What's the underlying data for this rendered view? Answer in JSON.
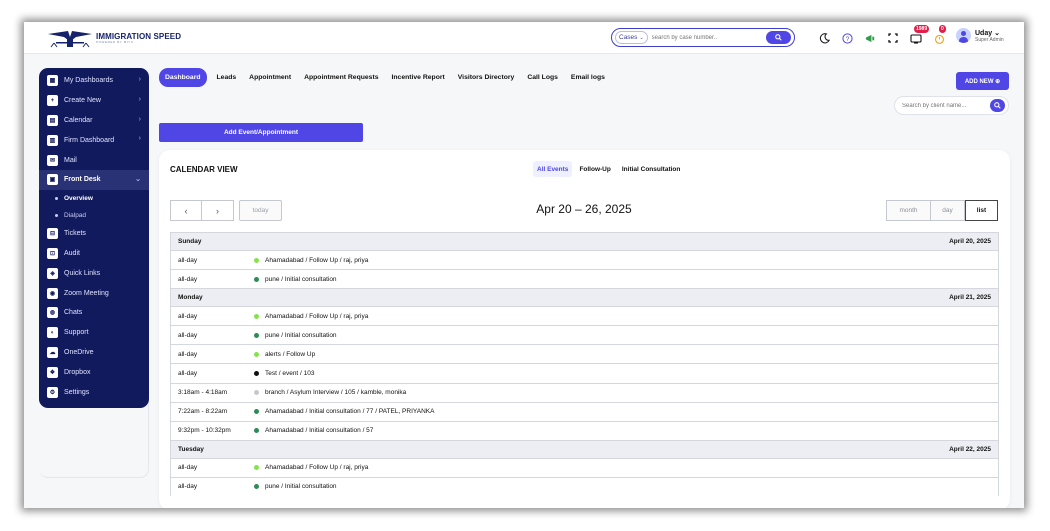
{
  "header": {
    "logo_name": "IMMIGRATION SPEED",
    "logo_sub": "POWERED BY MYIS",
    "case_select": "Cases",
    "search_placeholder": "search by case number..",
    "notif_badge": "1989",
    "alert_badge": "0",
    "user_name": "Uday",
    "user_role": "Super Admin"
  },
  "sidebar": {
    "items": [
      {
        "label": "My Dashboards",
        "icon": "grid-icon",
        "chev": true
      },
      {
        "label": "Create New",
        "icon": "plus-icon",
        "chev": true
      },
      {
        "label": "Calendar",
        "icon": "calendar-icon",
        "chev": true
      },
      {
        "label": "Firm Dashboard",
        "icon": "building-icon",
        "chev": true
      },
      {
        "label": "Mail",
        "icon": "mail-icon",
        "chev": false
      },
      {
        "label": "Front Desk",
        "icon": "desk-icon",
        "chev": true,
        "active": true
      }
    ],
    "sub_items": [
      {
        "label": "Overview",
        "active": true
      },
      {
        "label": "Dialpad",
        "active": false
      }
    ],
    "items2": [
      {
        "label": "Tickets",
        "icon": "ticket-icon"
      },
      {
        "label": "Audit",
        "icon": "audit-icon"
      },
      {
        "label": "Quick Links",
        "icon": "link-icon"
      },
      {
        "label": "Zoom Meeting",
        "icon": "video-icon"
      },
      {
        "label": "Chats",
        "icon": "chat-icon"
      },
      {
        "label": "Support",
        "icon": "headset-icon"
      },
      {
        "label": "OneDrive",
        "icon": "cloud-icon"
      },
      {
        "label": "Dropbox",
        "icon": "dropbox-icon"
      },
      {
        "label": "Settings",
        "icon": "gear-icon"
      }
    ]
  },
  "tabs": [
    "Dashboard",
    "Leads",
    "Appointment",
    "Appointment Requests",
    "Incentive Report",
    "Visitors Directory",
    "Call Logs",
    "Email logs"
  ],
  "add_new": "ADD NEW ⊕",
  "client_search_placeholder": "Search by client name...",
  "add_event": "Add Event/Appointment",
  "calendar": {
    "title": "CALENDAR VIEW",
    "filters": [
      "All Events",
      "Follow-Up",
      "Initial Consultation"
    ],
    "today": "today",
    "range": "Apr 20 – 26, 2025",
    "views": [
      "month",
      "day",
      "list"
    ],
    "days": [
      {
        "name": "Sunday",
        "date": "April 20, 2025",
        "events": [
          {
            "time": "all-day",
            "title": "Ahamadabad / Follow Up / raj, priya",
            "color": "#84e34a"
          },
          {
            "time": "all-day",
            "title": "pune / Initial consultation",
            "color": "#2e8b57"
          }
        ]
      },
      {
        "name": "Monday",
        "date": "April 21, 2025",
        "events": [
          {
            "time": "all-day",
            "title": "Ahamadabad / Follow Up / raj, priya",
            "color": "#84e34a"
          },
          {
            "time": "all-day",
            "title": "pune / Initial consultation",
            "color": "#2e8b57"
          },
          {
            "time": "all-day",
            "title": "alerts / Follow Up",
            "color": "#84e34a"
          },
          {
            "time": "all-day",
            "title": "Test / event / 103",
            "color": "#111111"
          },
          {
            "time": "3:18am - 4:18am",
            "title": "branch / Asylum Interview / 105 / kamble, monika",
            "color": "#c5c8cf"
          },
          {
            "time": "7:22am - 8:22am",
            "title": "Ahamadabad / Initial consultation / 77 / PATEL, PRIYANKA",
            "color": "#2e8b57"
          },
          {
            "time": "9:32pm - 10:32pm",
            "title": "Ahamadabad / Initial consultation / 57",
            "color": "#2e8b57"
          }
        ]
      },
      {
        "name": "Tuesday",
        "date": "April 22, 2025",
        "events": [
          {
            "time": "all-day",
            "title": "Ahamadabad / Follow Up / raj, priya",
            "color": "#84e34a"
          },
          {
            "time": "all-day",
            "title": "pune / Initial consultation",
            "color": "#2e8b57"
          }
        ]
      }
    ]
  },
  "colors": {
    "primary": "#4f46e5",
    "sidebar": "#121a5e"
  }
}
